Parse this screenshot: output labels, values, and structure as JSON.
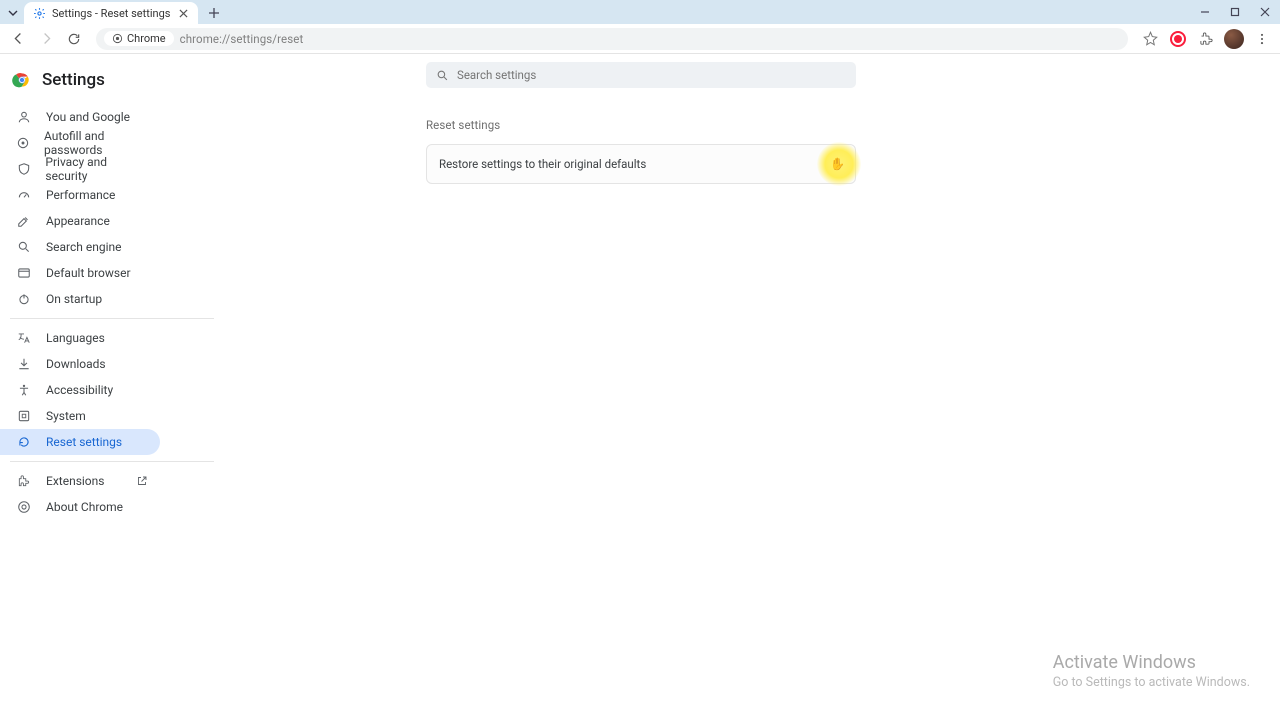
{
  "browser": {
    "tab_title": "Settings - Reset settings",
    "omnibox_chip": "Chrome",
    "url": "chrome://settings/reset"
  },
  "app": {
    "title": "Settings",
    "search_placeholder": "Search settings"
  },
  "sidebar": {
    "items": [
      {
        "id": "you-and-google",
        "label": "You and Google"
      },
      {
        "id": "autofill",
        "label": "Autofill and passwords"
      },
      {
        "id": "privacy",
        "label": "Privacy and security"
      },
      {
        "id": "performance",
        "label": "Performance"
      },
      {
        "id": "appearance",
        "label": "Appearance"
      },
      {
        "id": "search-engine",
        "label": "Search engine"
      },
      {
        "id": "default-browser",
        "label": "Default browser"
      },
      {
        "id": "on-startup",
        "label": "On startup"
      }
    ],
    "items2": [
      {
        "id": "languages",
        "label": "Languages"
      },
      {
        "id": "downloads",
        "label": "Downloads"
      },
      {
        "id": "accessibility",
        "label": "Accessibility"
      },
      {
        "id": "system",
        "label": "System"
      },
      {
        "id": "reset",
        "label": "Reset settings"
      }
    ],
    "items3": [
      {
        "id": "extensions",
        "label": "Extensions"
      },
      {
        "id": "about",
        "label": "About Chrome"
      }
    ],
    "selected": "reset"
  },
  "main": {
    "section_title": "Reset settings",
    "row_label": "Restore settings to their original defaults"
  },
  "watermark": {
    "title": "Activate Windows",
    "sub": "Go to Settings to activate Windows."
  }
}
